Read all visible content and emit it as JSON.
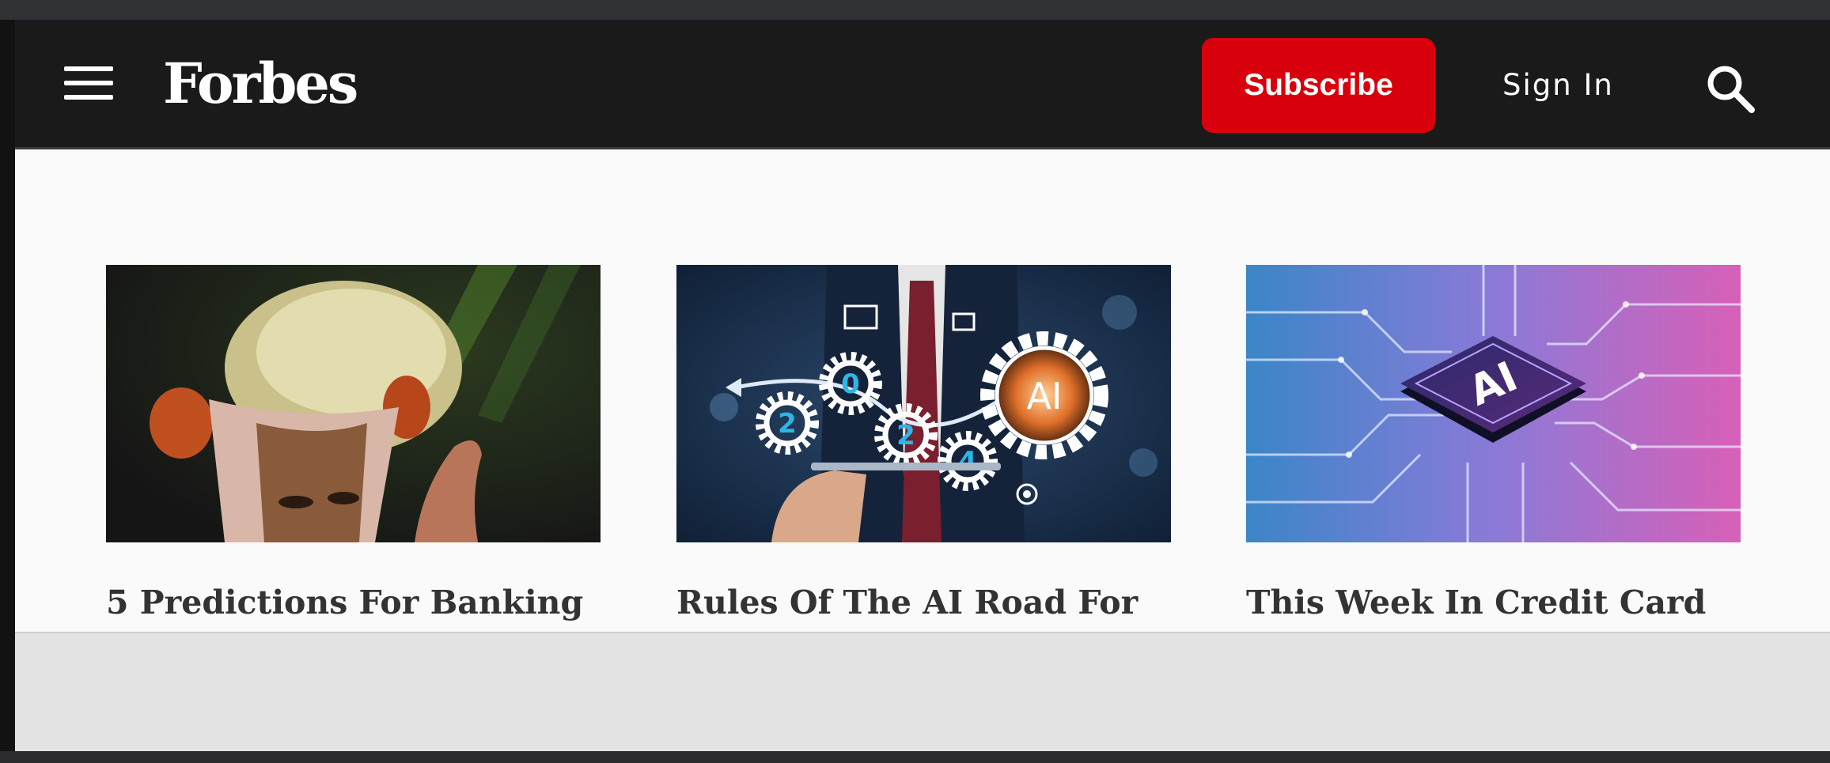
{
  "header": {
    "logo_text": "Forbes",
    "subscribe_label": "Subscribe",
    "signin_label": "Sign In",
    "menu_icon": "hamburger-menu-icon",
    "search_icon": "magnifier-search-icon"
  },
  "colors": {
    "header_bg": "#1a1a1a",
    "subscribe_red": "#d8000c",
    "content_bg": "#fafafa",
    "ad_bar": "#e3e3e3"
  },
  "articles": [
    {
      "title": "5 Predictions For Banking"
    },
    {
      "title": "Rules Of The AI Road For"
    },
    {
      "title": "This Week In Credit Card"
    }
  ],
  "illustrations": {
    "card2_badge": "AI",
    "card2_digits": [
      "0",
      "2",
      "2",
      "4"
    ],
    "card3_chip": "AI"
  }
}
